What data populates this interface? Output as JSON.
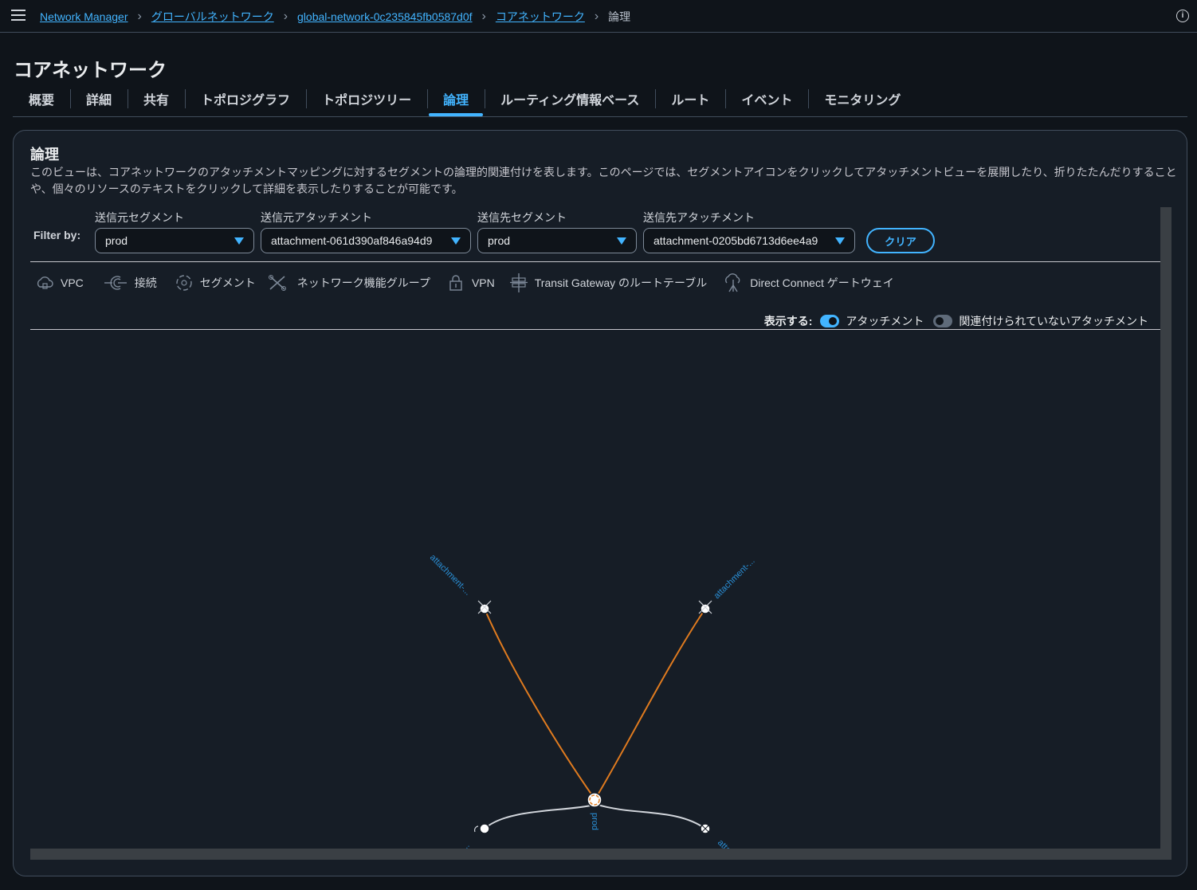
{
  "header": {
    "menu_icon": "hamburger-menu-icon",
    "breadcrumbs": [
      "Network Manager",
      "グローバルネットワーク",
      "global-network-0c235845fb0587d0f",
      "コアネットワーク"
    ],
    "current": "論理",
    "info_icon_glyph": "i"
  },
  "page": {
    "title": "コアネットワーク"
  },
  "tabs": [
    "概要",
    "詳細",
    "共有",
    "トポロジグラフ",
    "トポロジツリー",
    "論理",
    "ルーティング情報ベース",
    "ルート",
    "イベント",
    "モニタリング"
  ],
  "active_tab": "論理",
  "panel": {
    "title": "論理",
    "description": "このビューは、コアネットワークのアタッチメントマッピングに対するセグメントの論理的関連付けを表します。このページでは、セグメントアイコンをクリックしてアタッチメントビューを展開したり、折りたたんだりすることや、個々のリソースのテキストをクリックして詳細を表示したりすることが可能です。"
  },
  "filters": {
    "label": "Filter by:",
    "source_segment": {
      "label": "送信元セグメント",
      "value": "prod"
    },
    "source_attachment": {
      "label": "送信元アタッチメント",
      "value": "attachment-061d390af846a94d9"
    },
    "dest_segment": {
      "label": "送信先セグメント",
      "value": "prod"
    },
    "dest_attachment": {
      "label": "送信先アタッチメント",
      "value": "attachment-0205bd6713d6ee4a9"
    },
    "clear_label": "クリア"
  },
  "legend": [
    {
      "icon": "vpc-icon",
      "label": "VPC"
    },
    {
      "icon": "connect-icon",
      "label": "接続"
    },
    {
      "icon": "segment-icon",
      "label": "セグメント"
    },
    {
      "icon": "network-function-group-icon",
      "label": "ネットワーク機能グループ"
    },
    {
      "icon": "vpn-icon",
      "label": "VPN"
    },
    {
      "icon": "transit-gateway-route-table-icon",
      "label": "Transit Gateway のルートテーブル"
    },
    {
      "icon": "direct-connect-gateway-icon",
      "label": "Direct Connect ゲートウェイ"
    }
  ],
  "display": {
    "label": "表示する:",
    "attachments": {
      "label": "アタッチメント",
      "on": true
    },
    "unassociated": {
      "label": "関連付けられていないアタッチメント",
      "on": false
    }
  },
  "graph": {
    "center_label": "prod",
    "node_labels": [
      "attachment-...",
      "attachment-...",
      "attachment-...",
      "attachment-..."
    ],
    "colors": {
      "highlight_edge": "#e07b1f",
      "edge": "#d1d5db",
      "label": "#2a8fd6"
    }
  }
}
